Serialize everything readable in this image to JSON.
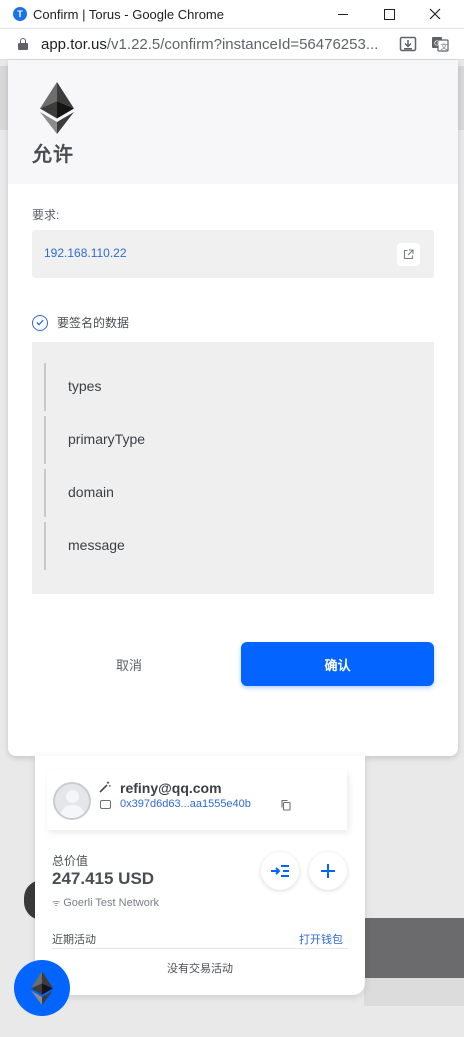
{
  "window": {
    "title": "Confirm | Torus - Google Chrome",
    "app_icon_letter": "T"
  },
  "addressbar": {
    "host": "app.tor.us",
    "path": "/v1.22.5/confirm?instanceId=56476253..."
  },
  "modal": {
    "title": "允许",
    "request_label": "要求:",
    "origin": "192.168.110.22",
    "sign_label": "要签名的数据",
    "data_items": [
      "types",
      "primaryType",
      "domain",
      "message"
    ],
    "cancel_label": "取消",
    "confirm_label": "确认"
  },
  "wallet": {
    "email": "refiny@qq.com",
    "address": "0x397d6d63...aa1555e40b",
    "total_label": "总价值",
    "total_value": "247.415 USD",
    "network": "Goerli Test Network",
    "recent_label": "近期活动",
    "open_wallet_label": "打开钱包",
    "no_activity": "没有交易活动"
  },
  "colors": {
    "accent": "#0364ff",
    "link": "#2f6ad3"
  },
  "icons": {
    "lock": "lock-icon",
    "install": "install-app-icon",
    "translate": "translate-icon",
    "eth": "ethereum-logo",
    "open_external": "open-external-icon",
    "check": "check-circle-icon",
    "wand": "magic-wand-icon",
    "wallet": "wallet-icon",
    "copy": "copy-icon",
    "transfer": "transfer-icon",
    "add": "plus-icon"
  }
}
